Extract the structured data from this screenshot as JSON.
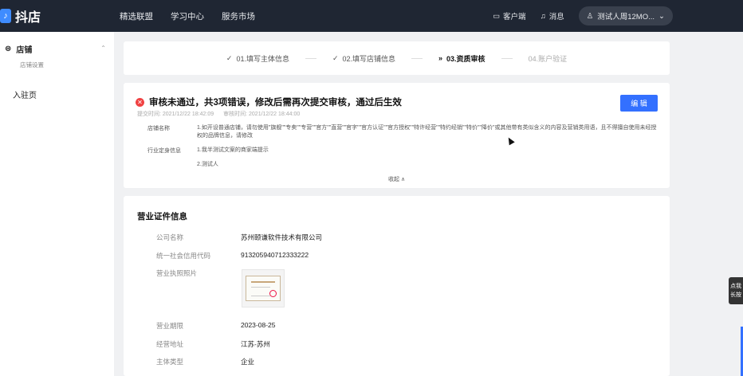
{
  "topbar": {
    "logo_text": "抖店",
    "nav": [
      "精选联盟",
      "学习中心",
      "服务市场"
    ],
    "client_label": "客户端",
    "message_label": "消息",
    "user_label": "测试人周12MO..."
  },
  "sidebar": {
    "group_label": "店铺",
    "group_sub": "店铺设置",
    "item_label": "入驻页"
  },
  "steps": [
    {
      "label": "01.填写主体信息",
      "status": "done"
    },
    {
      "label": "02.填写店铺信息",
      "status": "done"
    },
    {
      "label": "03.资质审核",
      "status": "current"
    },
    {
      "label": "04.账户验证",
      "status": "todo"
    }
  ],
  "review": {
    "title": "审核未通过，共3项错误，修改后需再次提交审核，通过后生效",
    "submit_time": "提交时间: 2021/12/22 18:42:09",
    "review_time": "审核时间: 2021/12/22 18:44:00",
    "edit_button": "编 辑",
    "errors": [
      {
        "key": "店铺名称",
        "value": "1.如开设普通店铺，请勿使用\"旗舰\"\"专卖\"\"专营\"\"官方\"\"直营\"\"官字\"\"官方认证\"\"官方授权\"\"特许经营\"\"特约经销\"\"特价\"\"降价\"或其他带有类似含义的内容及营销类用语，且不得擅自使用未经授权的品牌信息，请修改"
      },
      {
        "key": "行业定身信息",
        "value": "1.我半测试文案的商家端提示"
      },
      {
        "key": "",
        "value": "2.测试人"
      }
    ],
    "fold_label": "收起 ∧"
  },
  "license": {
    "section_title": "营业证件信息",
    "company_name_label": "公司名称",
    "company_name": "苏州颐谦软件技术有限公司",
    "credit_code_label": "统一社会信用代码",
    "credit_code": "913205940712333222",
    "photo_label": "营业执照照片",
    "period_label": "营业期限",
    "period": "2023-08-25",
    "address_label": "经营地址",
    "address": "江苏-苏州",
    "entity_label": "主体类型",
    "entity": "企业"
  },
  "float_tab": [
    "点我",
    "长按"
  ],
  "colors": {
    "accent": "#3370ff",
    "error": "#f04142",
    "topbar": "#1f2633"
  }
}
